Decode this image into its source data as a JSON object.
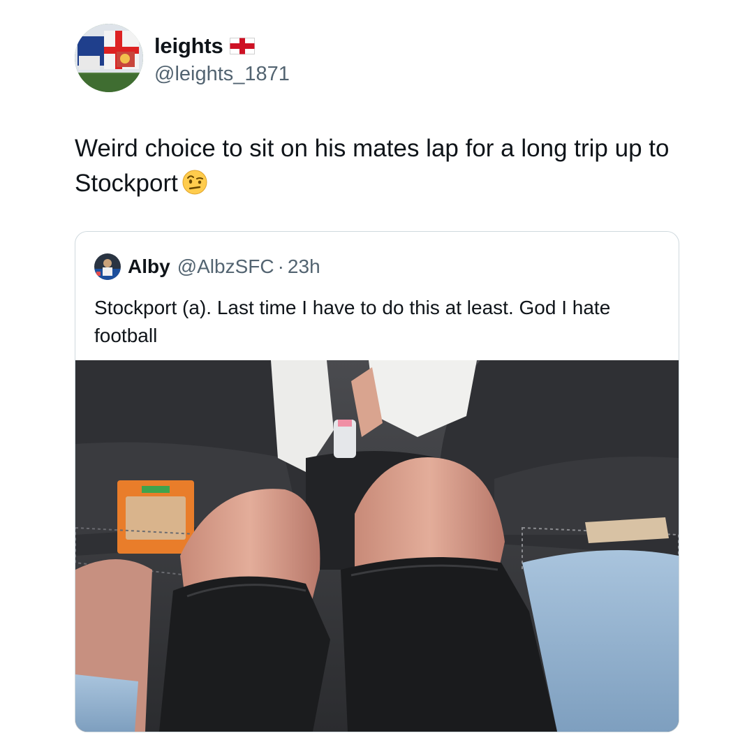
{
  "author": {
    "display_name": "leights",
    "flag_icon": "england-flag-icon",
    "handle": "@leights_1871"
  },
  "tweet": {
    "text": "Weird choice to sit on his mates lap for a long trip up to Stockport",
    "emoji_icon": "face-with-raised-eyebrow-icon"
  },
  "quoted_tweet": {
    "display_name": "Alby",
    "handle": "@AlbzSFC",
    "separator": "·",
    "time": "23h",
    "text": "Stockport (a). Last time I have to do this at least. God I hate football",
    "media_icon": "photo-car-backseat"
  },
  "colors": {
    "text": "#0f1419",
    "secondary": "#536471",
    "border": "#cfd9de"
  }
}
